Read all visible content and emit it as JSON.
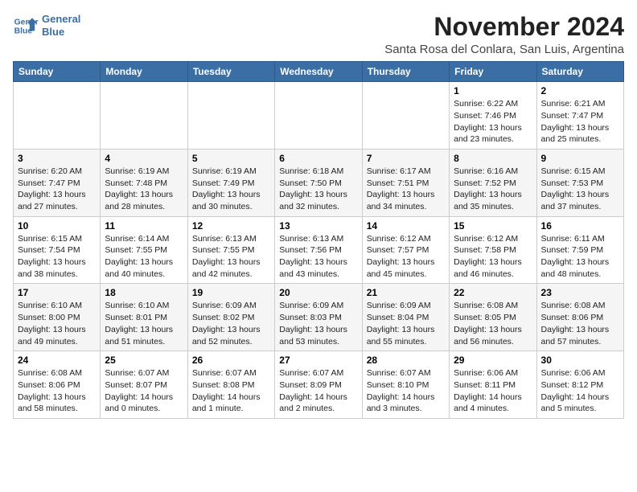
{
  "header": {
    "logo_line1": "General",
    "logo_line2": "Blue",
    "month_title": "November 2024",
    "subtitle": "Santa Rosa del Conlara, San Luis, Argentina"
  },
  "weekdays": [
    "Sunday",
    "Monday",
    "Tuesday",
    "Wednesday",
    "Thursday",
    "Friday",
    "Saturday"
  ],
  "weeks": [
    [
      {
        "day": "",
        "info": ""
      },
      {
        "day": "",
        "info": ""
      },
      {
        "day": "",
        "info": ""
      },
      {
        "day": "",
        "info": ""
      },
      {
        "day": "",
        "info": ""
      },
      {
        "day": "1",
        "info": "Sunrise: 6:22 AM\nSunset: 7:46 PM\nDaylight: 13 hours\nand 23 minutes."
      },
      {
        "day": "2",
        "info": "Sunrise: 6:21 AM\nSunset: 7:47 PM\nDaylight: 13 hours\nand 25 minutes."
      }
    ],
    [
      {
        "day": "3",
        "info": "Sunrise: 6:20 AM\nSunset: 7:47 PM\nDaylight: 13 hours\nand 27 minutes."
      },
      {
        "day": "4",
        "info": "Sunrise: 6:19 AM\nSunset: 7:48 PM\nDaylight: 13 hours\nand 28 minutes."
      },
      {
        "day": "5",
        "info": "Sunrise: 6:19 AM\nSunset: 7:49 PM\nDaylight: 13 hours\nand 30 minutes."
      },
      {
        "day": "6",
        "info": "Sunrise: 6:18 AM\nSunset: 7:50 PM\nDaylight: 13 hours\nand 32 minutes."
      },
      {
        "day": "7",
        "info": "Sunrise: 6:17 AM\nSunset: 7:51 PM\nDaylight: 13 hours\nand 34 minutes."
      },
      {
        "day": "8",
        "info": "Sunrise: 6:16 AM\nSunset: 7:52 PM\nDaylight: 13 hours\nand 35 minutes."
      },
      {
        "day": "9",
        "info": "Sunrise: 6:15 AM\nSunset: 7:53 PM\nDaylight: 13 hours\nand 37 minutes."
      }
    ],
    [
      {
        "day": "10",
        "info": "Sunrise: 6:15 AM\nSunset: 7:54 PM\nDaylight: 13 hours\nand 38 minutes."
      },
      {
        "day": "11",
        "info": "Sunrise: 6:14 AM\nSunset: 7:55 PM\nDaylight: 13 hours\nand 40 minutes."
      },
      {
        "day": "12",
        "info": "Sunrise: 6:13 AM\nSunset: 7:55 PM\nDaylight: 13 hours\nand 42 minutes."
      },
      {
        "day": "13",
        "info": "Sunrise: 6:13 AM\nSunset: 7:56 PM\nDaylight: 13 hours\nand 43 minutes."
      },
      {
        "day": "14",
        "info": "Sunrise: 6:12 AM\nSunset: 7:57 PM\nDaylight: 13 hours\nand 45 minutes."
      },
      {
        "day": "15",
        "info": "Sunrise: 6:12 AM\nSunset: 7:58 PM\nDaylight: 13 hours\nand 46 minutes."
      },
      {
        "day": "16",
        "info": "Sunrise: 6:11 AM\nSunset: 7:59 PM\nDaylight: 13 hours\nand 48 minutes."
      }
    ],
    [
      {
        "day": "17",
        "info": "Sunrise: 6:10 AM\nSunset: 8:00 PM\nDaylight: 13 hours\nand 49 minutes."
      },
      {
        "day": "18",
        "info": "Sunrise: 6:10 AM\nSunset: 8:01 PM\nDaylight: 13 hours\nand 51 minutes."
      },
      {
        "day": "19",
        "info": "Sunrise: 6:09 AM\nSunset: 8:02 PM\nDaylight: 13 hours\nand 52 minutes."
      },
      {
        "day": "20",
        "info": "Sunrise: 6:09 AM\nSunset: 8:03 PM\nDaylight: 13 hours\nand 53 minutes."
      },
      {
        "day": "21",
        "info": "Sunrise: 6:09 AM\nSunset: 8:04 PM\nDaylight: 13 hours\nand 55 minutes."
      },
      {
        "day": "22",
        "info": "Sunrise: 6:08 AM\nSunset: 8:05 PM\nDaylight: 13 hours\nand 56 minutes."
      },
      {
        "day": "23",
        "info": "Sunrise: 6:08 AM\nSunset: 8:06 PM\nDaylight: 13 hours\nand 57 minutes."
      }
    ],
    [
      {
        "day": "24",
        "info": "Sunrise: 6:08 AM\nSunset: 8:06 PM\nDaylight: 13 hours\nand 58 minutes."
      },
      {
        "day": "25",
        "info": "Sunrise: 6:07 AM\nSunset: 8:07 PM\nDaylight: 14 hours\nand 0 minutes."
      },
      {
        "day": "26",
        "info": "Sunrise: 6:07 AM\nSunset: 8:08 PM\nDaylight: 14 hours\nand 1 minute."
      },
      {
        "day": "27",
        "info": "Sunrise: 6:07 AM\nSunset: 8:09 PM\nDaylight: 14 hours\nand 2 minutes."
      },
      {
        "day": "28",
        "info": "Sunrise: 6:07 AM\nSunset: 8:10 PM\nDaylight: 14 hours\nand 3 minutes."
      },
      {
        "day": "29",
        "info": "Sunrise: 6:06 AM\nSunset: 8:11 PM\nDaylight: 14 hours\nand 4 minutes."
      },
      {
        "day": "30",
        "info": "Sunrise: 6:06 AM\nSunset: 8:12 PM\nDaylight: 14 hours\nand 5 minutes."
      }
    ]
  ]
}
